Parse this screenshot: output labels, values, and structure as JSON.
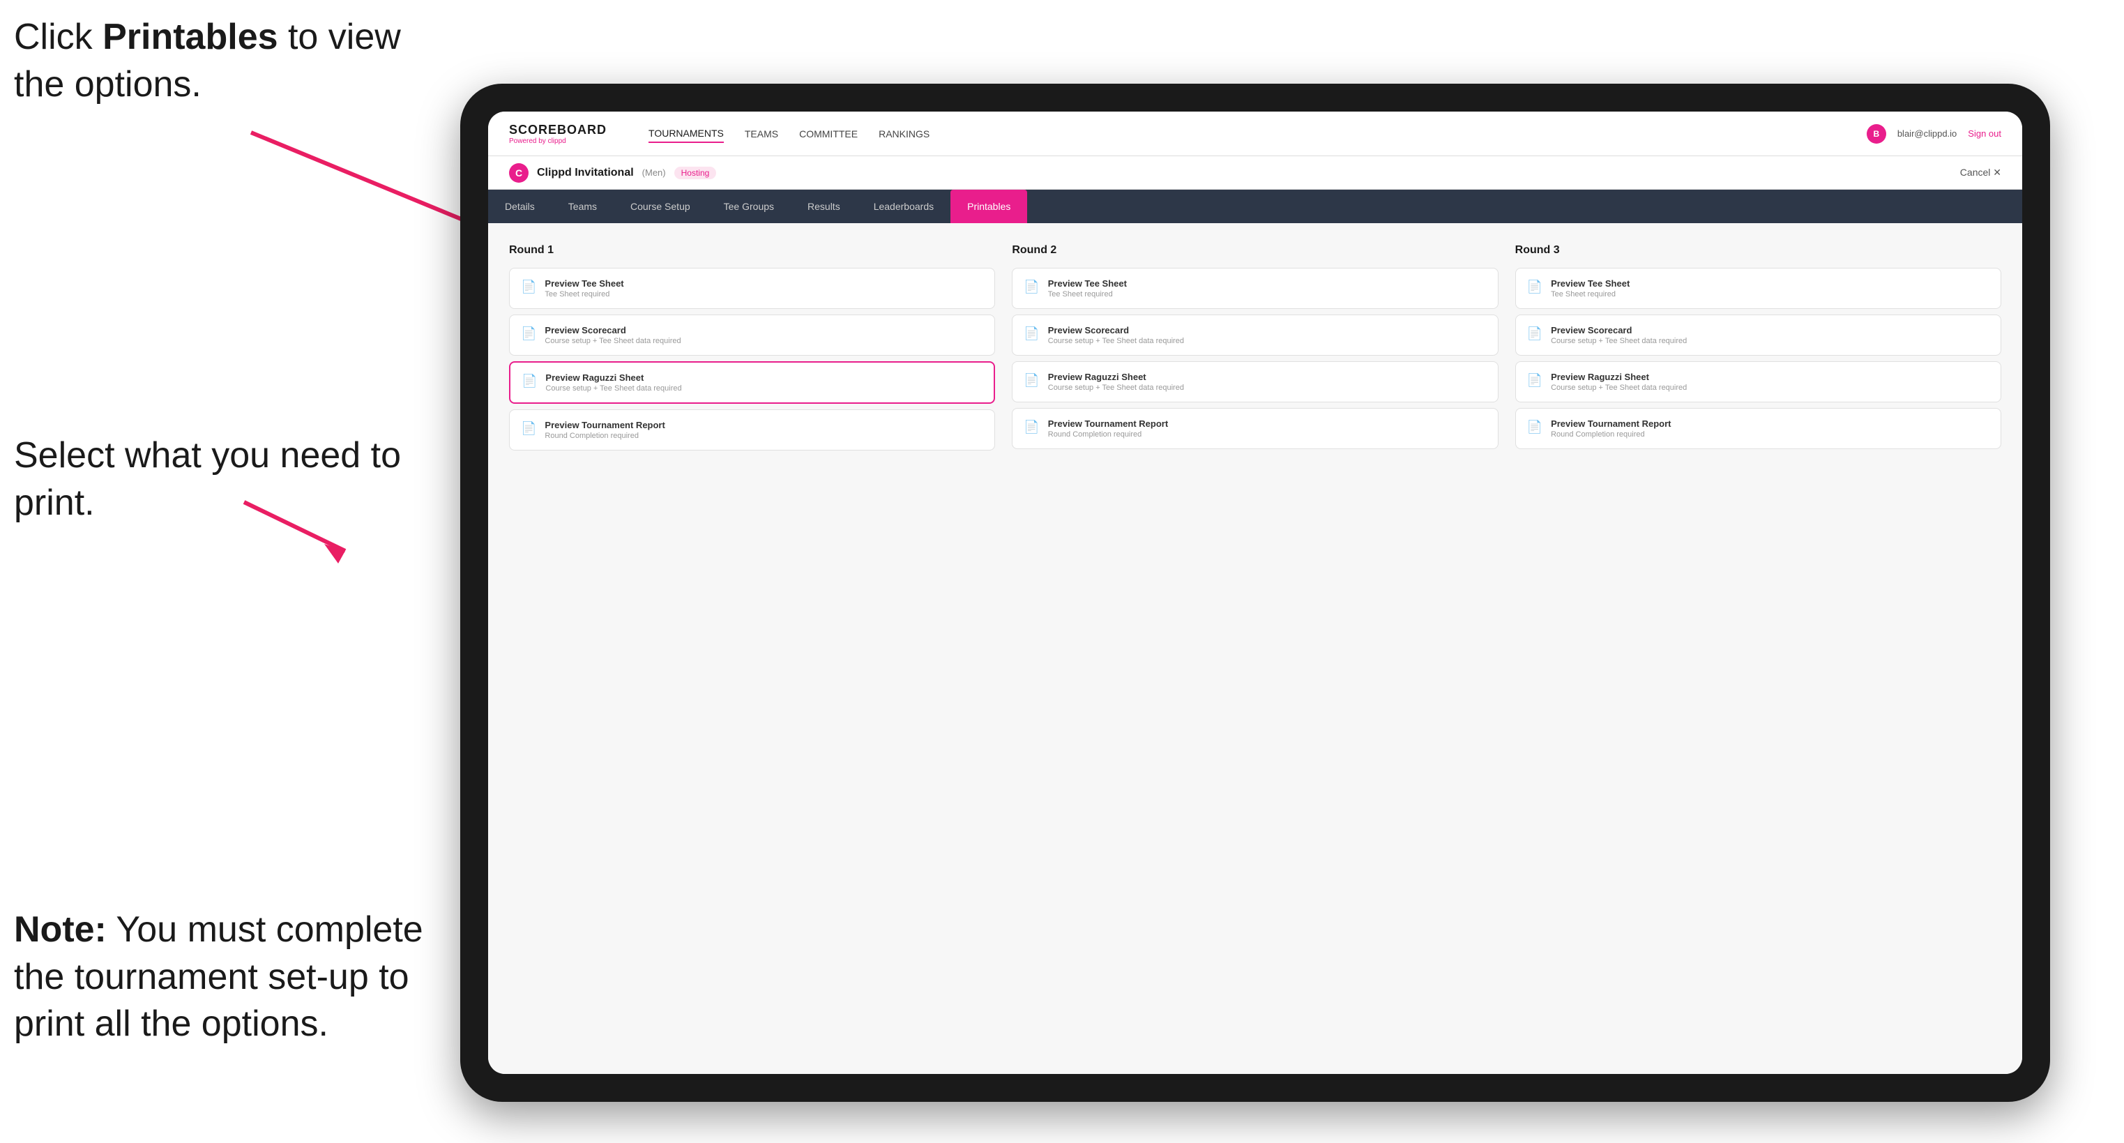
{
  "annotations": {
    "top": {
      "text_part1": "Click ",
      "bold": "Printables",
      "text_part2": " to view the options."
    },
    "middle": {
      "text_part1": "Select what you need to print."
    },
    "bottom": {
      "bold": "Note:",
      "text_part1": " You must complete the tournament set-up to print all the options."
    }
  },
  "topNav": {
    "brand": "SCOREBOARD",
    "brandSub": "Powered by clippd",
    "links": [
      "TOURNAMENTS",
      "TEAMS",
      "COMMITTEE",
      "RANKINGS"
    ],
    "activeLink": "TOURNAMENTS",
    "userEmail": "blair@clippd.io",
    "signOut": "Sign out"
  },
  "tournamentBar": {
    "logo": "C",
    "name": "Clippd Invitational",
    "tag": "(Men)",
    "hosting": "Hosting",
    "cancel": "Cancel ✕"
  },
  "subNav": {
    "tabs": [
      "Details",
      "Teams",
      "Course Setup",
      "Tee Groups",
      "Results",
      "Leaderboards",
      "Printables"
    ],
    "activeTab": "Printables"
  },
  "rounds": [
    {
      "title": "Round 1",
      "cards": [
        {
          "title": "Preview Tee Sheet",
          "sub": "Tee Sheet required"
        },
        {
          "title": "Preview Scorecard",
          "sub": "Course setup + Tee Sheet data required"
        },
        {
          "title": "Preview Raguzzi Sheet",
          "sub": "Course setup + Tee Sheet data required"
        },
        {
          "title": "Preview Tournament Report",
          "sub": "Round Completion required"
        }
      ]
    },
    {
      "title": "Round 2",
      "cards": [
        {
          "title": "Preview Tee Sheet",
          "sub": "Tee Sheet required"
        },
        {
          "title": "Preview Scorecard",
          "sub": "Course setup + Tee Sheet data required"
        },
        {
          "title": "Preview Raguzzi Sheet",
          "sub": "Course setup + Tee Sheet data required"
        },
        {
          "title": "Preview Tournament Report",
          "sub": "Round Completion required"
        }
      ]
    },
    {
      "title": "Round 3",
      "cards": [
        {
          "title": "Preview Tee Sheet",
          "sub": "Tee Sheet required"
        },
        {
          "title": "Preview Scorecard",
          "sub": "Course setup + Tee Sheet data required"
        },
        {
          "title": "Preview Raguzzi Sheet",
          "sub": "Course setup + Tee Sheet data required"
        },
        {
          "title": "Preview Tournament Report",
          "sub": "Round Completion required"
        }
      ]
    }
  ]
}
